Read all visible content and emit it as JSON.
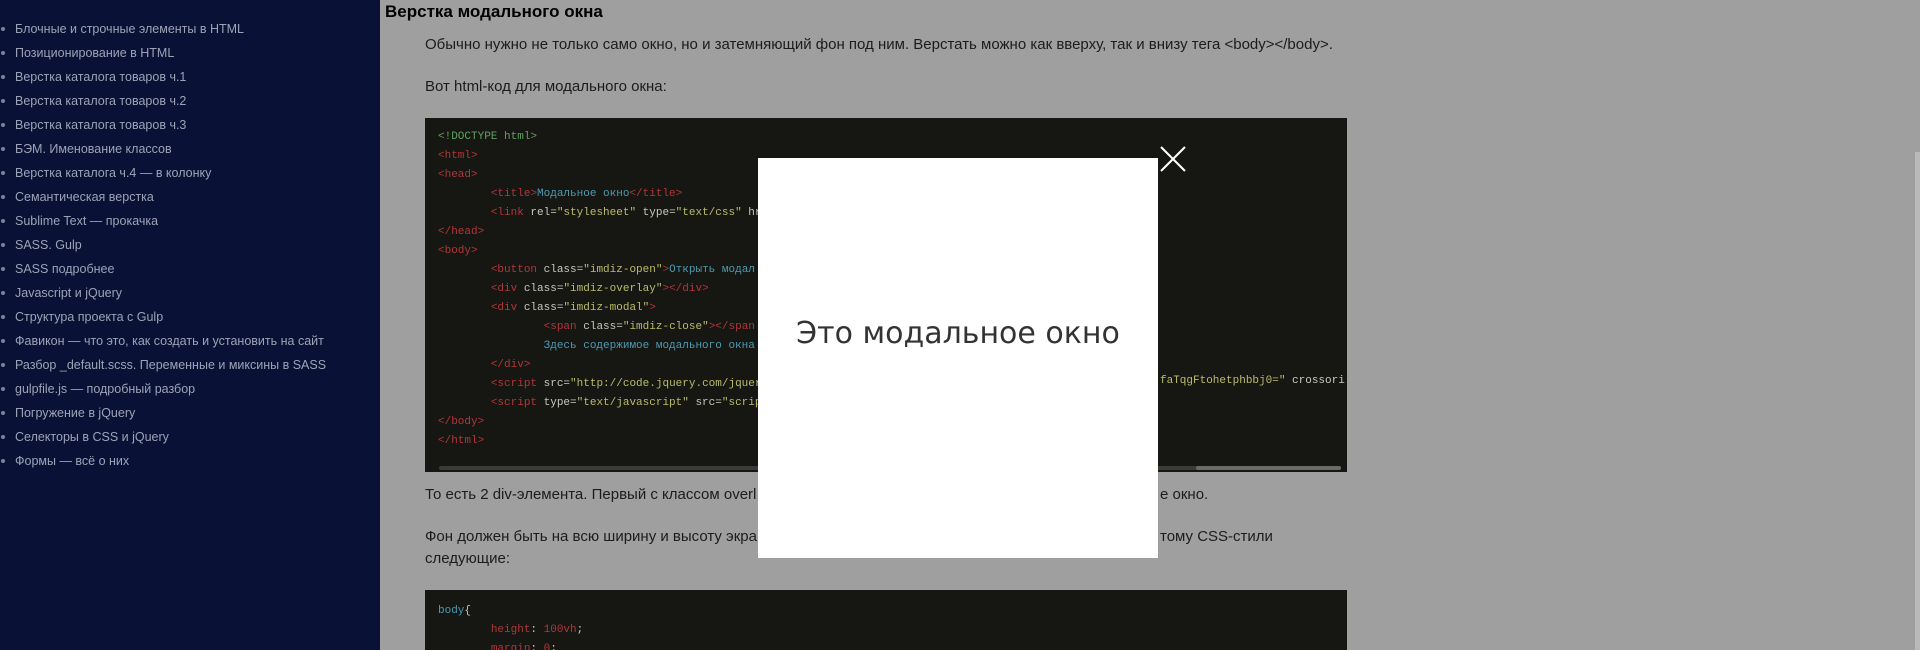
{
  "sidebar": {
    "items": [
      "Блочные и строчные элементы в HTML",
      "Позиционирование в HTML",
      "Верстка каталога товаров ч.1",
      "Верстка каталога товаров ч.2",
      "Верстка каталога товаров ч.3",
      "БЭМ. Именование классов",
      "Верстка каталога ч.4 — в колонку",
      "Семантическая верстка",
      "Sublime Text — прокачка",
      "SASS. Gulp",
      "SASS подробнее",
      "Javascript и jQuery",
      "Структура проекта с Gulp",
      "Фавикон — что это, как создать и установить на сайт",
      "Разбор _default.scss. Переменные и миксины в SASS",
      "gulpfile.js — подробный разбор",
      "Погружение в jQuery",
      "Селекторы в CSS и jQuery",
      "Формы — всё о них"
    ]
  },
  "main": {
    "title": "Верстка модального окна",
    "para1": "Обычно нужно не только само окно, но и затемняющий фон под ним. Верстать можно как вверху, так и внизу тега <body></body>.",
    "para2": "Вот html-код для модального окна:",
    "para3": "То есть 2 div-элемента. Первый с классом overl",
    "para3_tail": "е окно.",
    "para4_line1": "Фон должен быть на всю ширину и высоту экра",
    "para4_tail": "тому CSS-стили",
    "para4_line2": "следующие:"
  },
  "code1": {
    "l1": "<!DOCTYPE html>",
    "l2": "<html>",
    "l3": "<head>",
    "l4_open": "<title>",
    "l4_text": "Модальное окно",
    "l4_close": "</title>",
    "l5_tag": "<link",
    "l5_a1": " rel=",
    "l5_v1": "\"stylesheet\"",
    "l5_a2": " type=",
    "l5_v2": "\"text/css\"",
    "l5_a3": " hr",
    "l6": "</head>",
    "l7": "<body>",
    "l8_tag": "<button",
    "l8_a": " class=",
    "l8_v": "\"imdiz-open\"",
    "l8_gt": ">",
    "l8_text": "Открыть модал",
    "l9_tag": "<div",
    "l9_a": " class=",
    "l9_v": "\"imdiz-overlay\"",
    "l9_close": "></div>",
    "l10_tag": "<div",
    "l10_a": " class=",
    "l10_v": "\"imdiz-modal\"",
    "l10_gt": ">",
    "l11_tag": "<span",
    "l11_a": " class=",
    "l11_v": "\"imdiz-close\"",
    "l11_close": "></span",
    "l12_text": "Здесь содержимое модального окна",
    "l13": "</div>",
    "l14_tag": "<script",
    "l14_a": " src=",
    "l14_v": "\"http://code.jquery.com/jquer",
    "l14_tail_v": "faTqgFtohetphbbj0=\"",
    "l14_tail_a": " crossori",
    "l15_tag": "<script",
    "l15_a1": " type=",
    "l15_v1": "\"text/javascript\"",
    "l15_a2": " src=",
    "l15_v2": "\"scrip",
    "l16": "</body>",
    "l17": "</html>"
  },
  "code2": {
    "l1_sel": "body",
    "l1_brace": "{",
    "l2_prop": "height",
    "l2_colon": ": ",
    "l2_val": "100vh",
    "l2_semi": ";",
    "l3_prop": "margin",
    "l3_colon": ": ",
    "l3_val": "0",
    "l3_semi": ";"
  },
  "modal": {
    "text": "Это модальное окно"
  },
  "colors": {
    "sidebar_bg": "#091136",
    "overlay_main": "#9f9f9f",
    "code_bg": "#161612",
    "modal_bg": "#ffffff"
  }
}
